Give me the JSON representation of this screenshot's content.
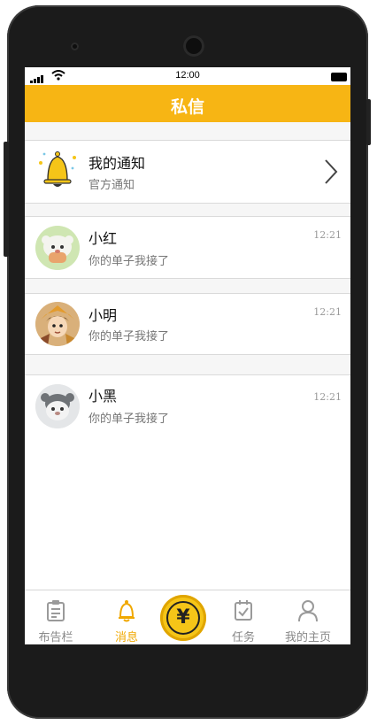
{
  "status_bar": {
    "time": "12:00"
  },
  "header": {
    "title": "私信"
  },
  "notification": {
    "title": "我的通知",
    "subtitle": "官方通知",
    "icon": "bell-icon",
    "arrow": "chevron-right-icon"
  },
  "messages": [
    {
      "name": "小红",
      "preview": "你的单子我接了",
      "time": "12:21"
    },
    {
      "name": "小明",
      "preview": "你的单子我接了",
      "time": "12:21"
    },
    {
      "name": "小黑",
      "preview": "你的单子我接了",
      "time": "12:21"
    }
  ],
  "tabs": [
    {
      "label": "布告栏",
      "icon": "clipboard-icon",
      "active": false
    },
    {
      "label": "消息",
      "icon": "bell-icon",
      "active": true
    },
    {
      "label": "",
      "icon": "yuan-icon",
      "active": false
    },
    {
      "label": "任务",
      "icon": "task-check-icon",
      "active": false
    },
    {
      "label": "我的主页",
      "icon": "user-icon",
      "active": false
    }
  ],
  "center_button": {
    "symbol": "¥"
  },
  "colors": {
    "accent": "#f7b514",
    "active_tab": "#f0a800"
  }
}
